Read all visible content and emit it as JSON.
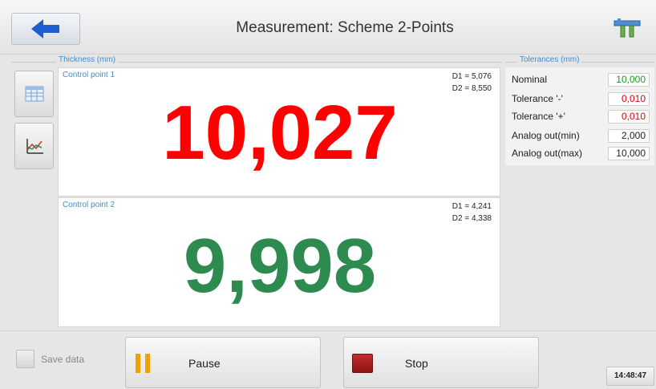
{
  "header": {
    "title": "Measurement: Scheme 2-Points",
    "back_icon": "arrow-left-icon",
    "tool_icon": "caliper-icon"
  },
  "thickness_group": {
    "label": "Thickness (mm)"
  },
  "tolerances_group": {
    "label": "Tolerances (mm)"
  },
  "sidebar": [
    {
      "icon": "table-icon"
    },
    {
      "icon": "chart-icon"
    }
  ],
  "points": [
    {
      "label": "Control point 1",
      "d1": "D1 = 5,076",
      "d2": "D2 = 8,550",
      "value": "10,027",
      "status_color": "#ff0000"
    },
    {
      "label": "Control point 2",
      "d1": "D1 = 4,241",
      "d2": "D2 = 4,338",
      "value": "9,998",
      "status_color": "#2e8b50"
    }
  ],
  "tolerances": [
    {
      "label": "Nominal",
      "value": "10,000",
      "color": "#1a9a1a"
    },
    {
      "label": "Tolerance '-'",
      "value": "0,010",
      "color": "#e00000"
    },
    {
      "label": "Tolerance '+'",
      "value": "0,010",
      "color": "#e00000"
    },
    {
      "label": "Analog out(min)",
      "value": "2,000",
      "color": "#222222"
    },
    {
      "label": "Analog out(max)",
      "value": "10,000",
      "color": "#222222"
    }
  ],
  "footer": {
    "save_data_label": "Save data",
    "pause_label": "Pause",
    "stop_label": "Stop",
    "clock": "14:48:47"
  }
}
